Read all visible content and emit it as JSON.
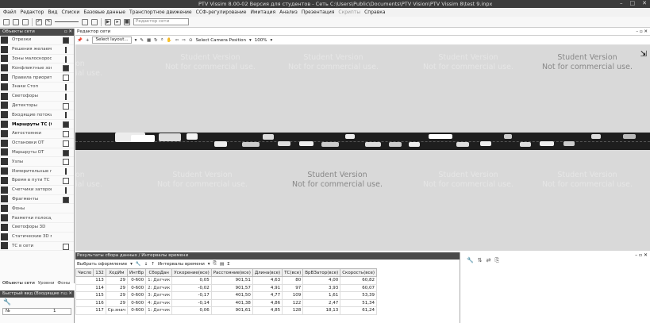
{
  "window": {
    "title": "PTV Vissim 8.00-02 Версия для студентов - Сеть C:\\Users\\Public\\Documents\\PTV Vision\\PTV Vissim 8\\test 9.inpx",
    "buttons": [
      "–",
      "□",
      "✕"
    ]
  },
  "menu": {
    "items": [
      "Файл",
      "Редактор",
      "Вид",
      "Списки",
      "Базовые данные",
      "Транспортное движение",
      "ССФ-регулирование",
      "Имитация",
      "Анализ",
      "Презентация",
      "Скрипты",
      "Справка"
    ],
    "disabled": [
      10
    ]
  },
  "toolbar": {
    "editor_combo": "Редактор сети"
  },
  "left_panel": {
    "title": "Объекты сети",
    "header_buttons": "▫ ✕",
    "items": [
      {
        "label": "Отрезки",
        "icon": "links-icon",
        "swatch": "dark"
      },
      {
        "label": "Решения желаемо",
        "icon": "desired-speed-icon",
        "swatch": "bar"
      },
      {
        "label": "Зоны малоскорос",
        "icon": "reduced-speed-icon",
        "swatch": "bar"
      },
      {
        "label": "Конфликтные зон",
        "icon": "conflict-areas-icon",
        "swatch": "dark"
      },
      {
        "label": "Правила приорит",
        "icon": "priority-rules-icon",
        "swatch": "box"
      },
      {
        "label": "Знаки Стоп",
        "icon": "stop-signs-icon",
        "swatch": "bar"
      },
      {
        "label": "Светофоры",
        "icon": "signal-heads-icon",
        "swatch": "bar"
      },
      {
        "label": "Детекторы",
        "icon": "detectors-icon",
        "swatch": "box"
      },
      {
        "label": "Входящие потоки",
        "icon": "vehicle-inputs-icon",
        "swatch": "bar"
      },
      {
        "label": "Маршруты ТС (С",
        "icon": "vehicle-routes-icon",
        "swatch": "dark",
        "bold": true
      },
      {
        "label": "Автостоянки",
        "icon": "parking-lots-icon",
        "swatch": "box"
      },
      {
        "label": "Остановки ОТ",
        "icon": "pt-stops-icon",
        "swatch": "box"
      },
      {
        "label": "Маршруты ОТ",
        "icon": "pt-lines-icon",
        "swatch": "dark"
      },
      {
        "label": "Узлы",
        "icon": "nodes-icon",
        "swatch": "box"
      },
      {
        "label": "Измерительные п",
        "icon": "data-collection-icon",
        "swatch": "bar"
      },
      {
        "label": "Время в пути ТС",
        "icon": "travel-times-icon",
        "swatch": "box"
      },
      {
        "label": "Счетчики заторов",
        "icon": "queue-counters-icon",
        "swatch": "bar"
      },
      {
        "label": "Фрагменты",
        "icon": "sections-icon",
        "swatch": "dark"
      },
      {
        "label": "Фоны",
        "icon": "backgrounds-icon",
        "swatch": "none"
      },
      {
        "label": "Разметки полосад",
        "icon": "pavement-markings-icon",
        "swatch": "none"
      },
      {
        "label": "Светофоры 3D",
        "icon": "3d-signal-icon",
        "swatch": "none"
      },
      {
        "label": "Статические 3D м",
        "icon": "static-3d-icon",
        "swatch": "none"
      },
      {
        "label": "ТС в сети",
        "icon": "vehicles-in-network-icon",
        "swatch": "box"
      }
    ],
    "tabs": [
      "Объекты сети",
      "Уровни",
      "Фоны"
    ]
  },
  "quick_view": {
    "title": "Быстрый вид (Входящие п...",
    "header_buttons": "▫ ✕",
    "field_name": "№",
    "field_value": "1"
  },
  "editor": {
    "title": "Редактор сети",
    "header_buttons": "– ▫ ✕",
    "layout_combo": "Select layout...",
    "camera_label": "Select Camera Position",
    "zoom": "100%",
    "watermark_line1": "Student Version",
    "watermark_line2": "Not for commercial use.",
    "cutoff_line1": "on",
    "cutoff_line2": "ial use."
  },
  "results": {
    "title": "Результаты сбора данных / Интервалы времени",
    "toolbar_label": "Выбрать оформление",
    "interval_label": "Интервалы времени",
    "columns": [
      "Число",
      "132",
      "ХодИм",
      "ИнтВр",
      "СборДан",
      "Ускорение(все)",
      "Расстояние(все)",
      "Длина(все)",
      "ТС(все)",
      "ВрВЗатор(все)",
      "Скорость(все)"
    ],
    "rows": [
      [
        "113",
        "29",
        "0-600",
        "1: Датчик",
        "0,05",
        "901,51",
        "4,63",
        "80",
        "4,00",
        "60,82"
      ],
      [
        "114",
        "29",
        "0-600",
        "2: Датчик",
        "-0,02",
        "901,57",
        "4,91",
        "97",
        "3,93",
        "60,07"
      ],
      [
        "115",
        "29",
        "0-600",
        "3: Датчик",
        "-0,17",
        "401,50",
        "4,77",
        "109",
        "1,61",
        "53,39"
      ],
      [
        "116",
        "29",
        "0-600",
        "4: Датчик",
        "-0,14",
        "401,38",
        "4,86",
        "122",
        "2,47",
        "51,34"
      ],
      [
        "117",
        "Ср.знач",
        "0-600",
        "1: Датчик",
        "0,06",
        "901,61",
        "4,85",
        "128",
        "18,13",
        "61,24"
      ]
    ]
  }
}
